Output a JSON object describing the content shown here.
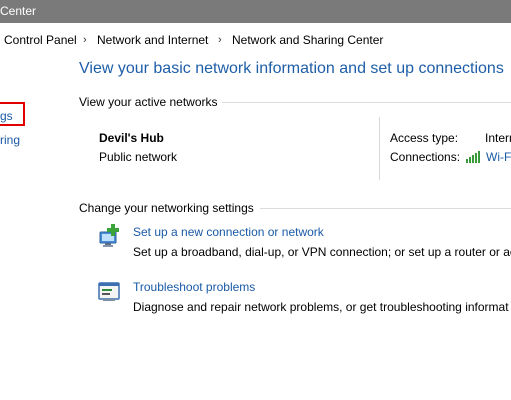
{
  "window": {
    "title": "Center"
  },
  "breadcrumb": {
    "items": [
      "Control Panel",
      "Network and Internet",
      "Network and Sharing Center"
    ],
    "separator": "›"
  },
  "left_pane": {
    "links": [
      "gs",
      "ring"
    ]
  },
  "main": {
    "title": "View your basic network information and set up connections",
    "active_networks_header": "View your active networks",
    "network": {
      "name": "Devil's Hub",
      "category": "Public network",
      "access_type_label": "Access type:",
      "access_type_value": "Intern",
      "connections_label": "Connections:",
      "connections_value": "Wi-F"
    },
    "change_settings_header": "Change your networking settings",
    "tasks": [
      {
        "icon": "new-connection-icon",
        "link": "Set up a new connection or network",
        "description": "Set up a broadband, dial-up, or VPN connection; or set up a router or ac"
      },
      {
        "icon": "troubleshoot-icon",
        "link": "Troubleshoot problems",
        "description": "Diagnose and repair network problems, or get troubleshooting informat"
      }
    ]
  },
  "colors": {
    "titlebar": "#7a7a7a",
    "link": "#1a5aa6",
    "title": "#1e5ea8",
    "highlight": "#e00000",
    "signal": "#3a9a3a"
  }
}
